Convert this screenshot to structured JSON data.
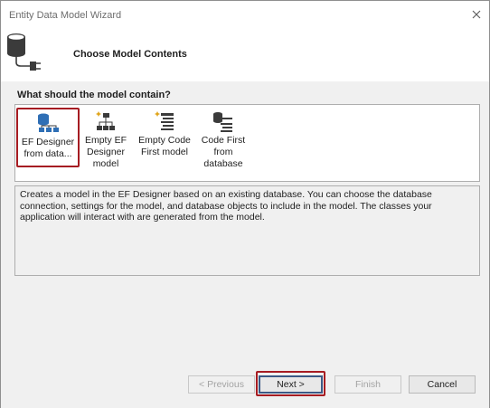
{
  "window": {
    "title": "Entity Data Model Wizard",
    "close_icon": "close-icon"
  },
  "header": {
    "icon": "database-plug-icon",
    "title": "Choose Model Contents"
  },
  "main": {
    "question": "What should the model contain?",
    "selected_choice": 0,
    "choices": [
      {
        "label_lines": [
          "EF Designer",
          "from data..."
        ],
        "icon": "ef-designer-database-icon"
      },
      {
        "label_lines": [
          "Empty EF",
          "Designer",
          "model"
        ],
        "icon": "empty-designer-icon"
      },
      {
        "label_lines": [
          "Empty Code",
          "First model"
        ],
        "icon": "empty-code-first-icon"
      },
      {
        "label_lines": [
          "Code First",
          "from",
          "database"
        ],
        "icon": "code-first-database-icon"
      }
    ],
    "description": "Creates a model in the EF Designer based on an existing database. You can choose the database connection, settings for the model, and database objects to include in the model. The classes your application will interact with are generated from the model."
  },
  "buttons": {
    "previous": "< Previous",
    "next": "Next >",
    "finish": "Finish",
    "cancel": "Cancel"
  },
  "colors": {
    "highlight": "#a61c22",
    "panel_background": "#f0f0f0",
    "icon_blue": "#2f6fb5",
    "icon_dark": "#3b3b3b"
  }
}
